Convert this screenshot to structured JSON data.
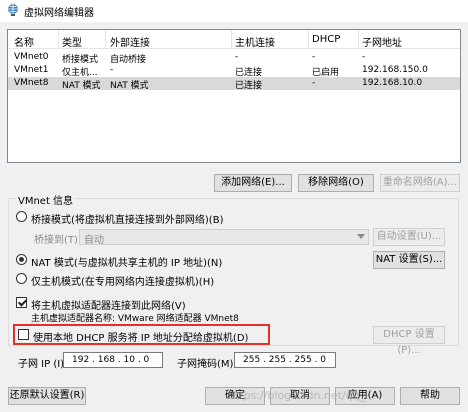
{
  "window": {
    "title": "虚拟网络编辑器"
  },
  "table": {
    "headers": [
      "名称",
      "类型",
      "外部连接",
      "主机连接",
      "DHCP",
      "子网地址"
    ],
    "rows": [
      [
        "VMnet0",
        "桥接模式",
        "自动桥接",
        "-",
        "-",
        "-"
      ],
      [
        "VMnet1",
        "仅主机...",
        "-",
        "已连接",
        "已启用",
        "192.168.150.0"
      ],
      [
        "VMnet8",
        "NAT 模式",
        "NAT 模式",
        "已连接",
        "-",
        "192.168.10.0"
      ]
    ],
    "selected_row": 2
  },
  "network_buttons": {
    "add": "添加网络(E)...",
    "remove": "移除网络(O)",
    "rename": "重命名网络(A)..."
  },
  "vmnet_info": {
    "label": "VMnet 信息",
    "bridge_mode": "桥接模式(将虚拟机直接连接到外部网络)(B)",
    "bridge_to_label": "桥接到(T):",
    "bridge_to_value": "自动",
    "auto_settings": "自动设置(U)...",
    "nat_mode": "NAT 模式(与虚拟机共享主机的 IP 地址)(N)",
    "nat_settings": "NAT 设置(S)...",
    "host_only": "仅主机模式(在专用网络内连接虚拟机)(H)",
    "connect_adapter": "将主机虚拟适配器连接到此网络(V)",
    "adapter_name": "主机虚拟适配器名称: VMware 网络适配器 VMnet8",
    "use_dhcp": "使用本地 DHCP 服务将 IP 地址分配给虚拟机(D)",
    "dhcp_settings": "DHCP 设置(P)...",
    "subnet_ip_label": "子网 IP (I):",
    "subnet_ip_value": "192 . 168 . 10 . 0",
    "subnet_mask_label": "子网掩码(M):",
    "subnet_mask_value": "255 . 255 . 255 . 0"
  },
  "footer": {
    "restore": "还原默认设置(R)",
    "ok": "确定",
    "cancel": "取消",
    "apply": "应用(A)",
    "help": "帮助"
  },
  "watermark": "https://blog.csdn.net/qq_..."
}
